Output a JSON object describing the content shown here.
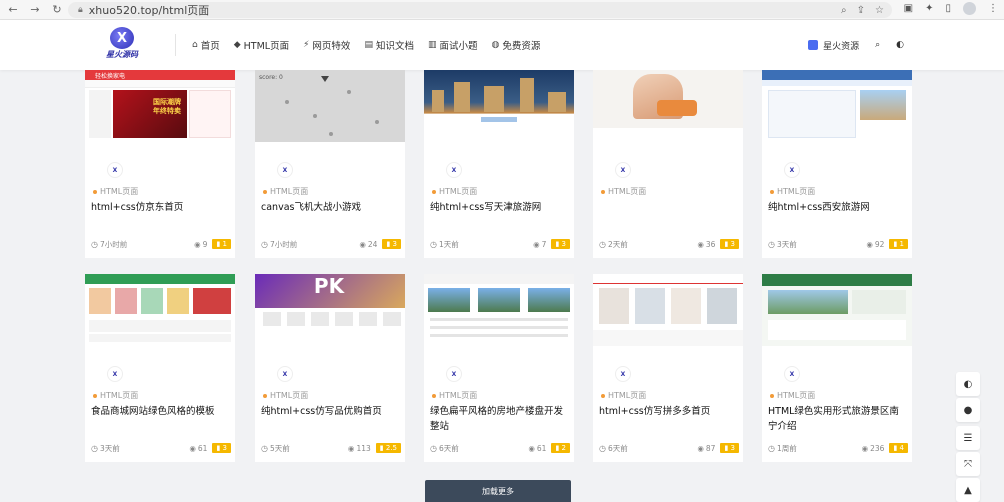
{
  "browser": {
    "url": "xhuo520.top/html页面"
  },
  "site": {
    "logo_text": "星火源码",
    "nav": [
      {
        "icon": "home-icon",
        "glyph": "⌂",
        "label": "首页"
      },
      {
        "icon": "html5-icon",
        "glyph": "◆",
        "label": "HTML页面"
      },
      {
        "icon": "bolt-icon",
        "glyph": "⚡",
        "label": "网页特效"
      },
      {
        "icon": "document-icon",
        "glyph": "▤",
        "label": "知识文档"
      },
      {
        "icon": "chart-icon",
        "glyph": "▥",
        "label": "面试小题"
      },
      {
        "icon": "fire-icon",
        "glyph": "◍",
        "label": "免费资源"
      }
    ],
    "user_label": "星火资源"
  },
  "cards": [
    {
      "category": "HTML页面",
      "title": "html+css仿京东首页",
      "time": "7小时前",
      "views": "9",
      "badge": "1"
    },
    {
      "category": "HTML页面",
      "title": "canvas飞机大战小游戏",
      "time": "7小时前",
      "views": "24",
      "badge": "3"
    },
    {
      "category": "HTML页面",
      "title": "纯html+css写天津旅游网",
      "time": "1天前",
      "views": "7",
      "badge": "3"
    },
    {
      "category": "HTML页面",
      "title": "",
      "time": "2天前",
      "views": "36",
      "badge": "3"
    },
    {
      "category": "HTML页面",
      "title": "纯html+css西安旅游网",
      "time": "3天前",
      "views": "92",
      "badge": "1"
    },
    {
      "category": "HTML页面",
      "title": "食品商城网站绿色风格的模板",
      "time": "3天前",
      "views": "61",
      "badge": "3"
    },
    {
      "category": "HTML页面",
      "title": "纯html+css仿写品优购首页",
      "time": "5天前",
      "views": "113",
      "badge": "2.5"
    },
    {
      "category": "HTML页面",
      "title": "绿色扁平风格的房地产楼盘开发整站",
      "time": "6天前",
      "views": "61",
      "badge": "2"
    },
    {
      "category": "HTML页面",
      "title": "html+css仿写拼多多首页",
      "time": "6天前",
      "views": "87",
      "badge": "3"
    },
    {
      "category": "HTML页面",
      "title": "HTML绿色实用形式旅游景区南宁介绍",
      "time": "1周前",
      "views": "236",
      "badge": "4"
    }
  ],
  "thumb_text": {
    "jd_banner_line1": "国际潮牌",
    "jd_banner_line2": "年终特卖",
    "jd_ad": "轻松换家电",
    "game_score": "score: 0",
    "pk_text": "PK"
  },
  "load_more_label": "加载更多",
  "floating": [
    {
      "icon": "theme-toggle-icon",
      "glyph": "◐"
    },
    {
      "icon": "qq-icon",
      "glyph": "●"
    },
    {
      "icon": "list-icon",
      "glyph": "☰"
    },
    {
      "icon": "expand-icon",
      "glyph": "⤧"
    },
    {
      "icon": "back-to-top-icon",
      "glyph": "▲"
    }
  ],
  "colors": {
    "accent_badge": "#f5b800",
    "category_dot": "#f29b38",
    "load_more_bg": "#3c4a5b"
  }
}
